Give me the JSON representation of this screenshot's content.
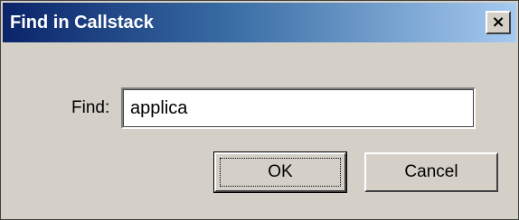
{
  "window": {
    "title": "Find in Callstack",
    "close_glyph": "×"
  },
  "form": {
    "find_label": "Find:",
    "find_value": "applica"
  },
  "buttons": {
    "ok_label": "OK",
    "cancel_label": "Cancel"
  }
}
